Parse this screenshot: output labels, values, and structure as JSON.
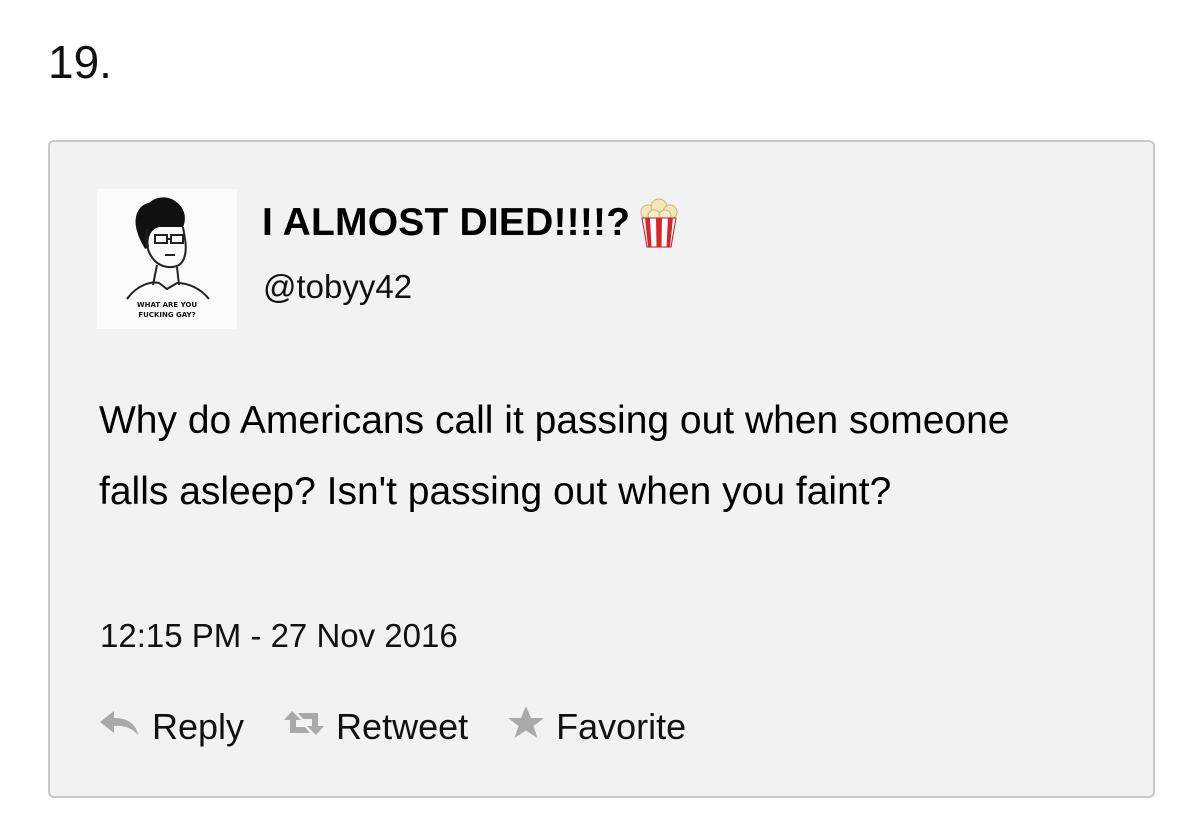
{
  "item": {
    "number": "19."
  },
  "tweet": {
    "display_name": "I ALMOST DIED!!!!?",
    "name_emoji": "popcorn-icon",
    "handle": "@tobyy42",
    "avatar": {
      "caption_line1": "WHAT ARE YOU",
      "caption_line2": "FUCKING GAY?"
    },
    "text": "Why do Americans call it passing out when someone falls asleep? Isn't passing out when you faint?",
    "timestamp": "12:15 PM - 27 Nov 2016",
    "actions": {
      "reply": {
        "label": "Reply",
        "icon": "reply-icon"
      },
      "retweet": {
        "label": "Retweet",
        "icon": "retweet-icon"
      },
      "favorite": {
        "label": "Favorite",
        "icon": "star-icon"
      }
    }
  },
  "colors": {
    "card_background": "#f2f2f2",
    "card_border": "#c8c8c8",
    "icon_gray": "#a9a9a9",
    "popcorn_red": "#d9262c",
    "popcorn_kernel": "#f5e7b8"
  }
}
